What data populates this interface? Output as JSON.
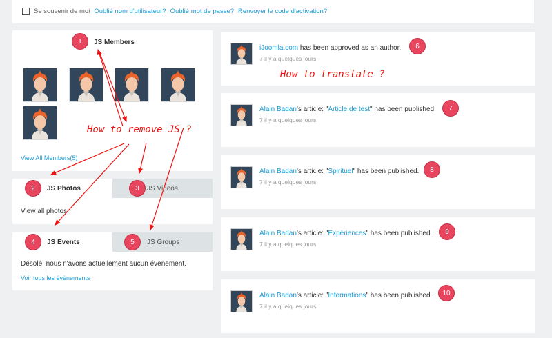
{
  "login": {
    "remember_label": "Se souvenir de moi",
    "forgot_username": "Oublié nom d'utilisateur?",
    "forgot_password": "Oublié mot de passe?",
    "resend_activation": "Renvoyer le code d'activation?"
  },
  "members": {
    "title": "JS Members",
    "view_all": "View All Members(5)"
  },
  "photos": {
    "tab_photos": "JS Photos",
    "tab_videos": "JS Videos",
    "view_all": "View all photos"
  },
  "events": {
    "tab_events": "JS Events",
    "tab_groups": "JS Groups",
    "empty_text": "Désolé, nous n'avons actuellement aucun évènement.",
    "view_all": "Voir tous les évènements"
  },
  "activities": [
    {
      "actor": "iJoomla.com",
      "text": " has been approved as an author.",
      "time": "7 il y a quelques jours"
    },
    {
      "actor": "Alain Badan",
      "pre": "'s article: \"",
      "link": "Article de test",
      "post": "\" has been published.",
      "time": "7 il y a quelques jours"
    },
    {
      "actor": "Alain Badan",
      "pre": "'s article: \"",
      "link": "Spirituel",
      "post": "\" has been published.",
      "time": "7 il y a quelques jours"
    },
    {
      "actor": "Alain Badan",
      "pre": "'s article: \"",
      "link": "Expériences",
      "post": "\" has been published.",
      "time": "7 il y a quelques jours"
    },
    {
      "actor": "Alain Badan",
      "pre": "'s article: \"",
      "link": "Informations",
      "post": "\" has been published.",
      "time": "7 il y a quelques jours"
    }
  ],
  "annotations": {
    "badges": [
      "1",
      "2",
      "3",
      "4",
      "5",
      "6",
      "7",
      "8",
      "9",
      "10"
    ],
    "translate_note": "How to translate ?",
    "remove_note": "How to remove JS ?"
  },
  "colors": {
    "accent": "#1a9fd9",
    "badge": "#e8455f",
    "annotation": "#e11111",
    "avatar_bg": "#31465a"
  },
  "icons": {
    "avatar": "user-avatar-icon",
    "checkbox": "checkbox-icon"
  }
}
